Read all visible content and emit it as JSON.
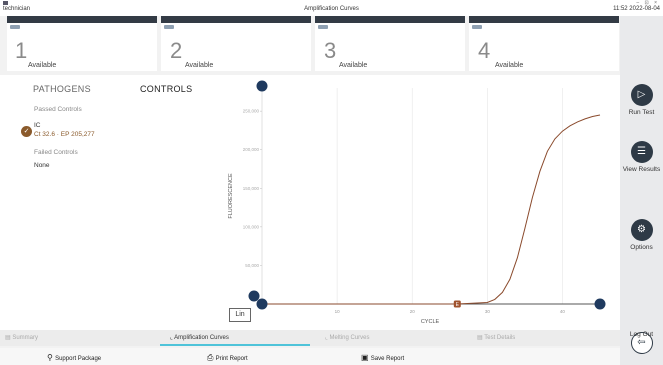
{
  "window": {
    "user": "technician",
    "title": "Amplification Curves",
    "clock": "11:52 2022-08-04",
    "controls": "–  ⊡  ×"
  },
  "modules": [
    {
      "number": "1",
      "status": "Available"
    },
    {
      "number": "2",
      "status": "Available"
    },
    {
      "number": "3",
      "status": "Available"
    },
    {
      "number": "4",
      "status": "Available"
    }
  ],
  "left_panel": {
    "tab_pathogens": "PATHOGENS",
    "tab_controls": "CONTROLS",
    "passed_label": "Passed Controls",
    "control_name": "IC",
    "control_detail": "Ct 32.6 · EP 205,277",
    "failed_label": "Failed Controls",
    "failed_value": "None"
  },
  "chart_controls": {
    "scale_button": "Lin"
  },
  "chart_data": {
    "type": "line",
    "xlabel": "CYCLE",
    "ylabel": "FLUORESCENCE",
    "xlim": [
      0,
      45
    ],
    "ylim": [
      0,
      280000
    ],
    "x_ticks": [
      10,
      20,
      30,
      40
    ],
    "y_ticks": [
      50000,
      100000,
      150000,
      200000,
      250000
    ],
    "y_tick_labels": [
      "50,000",
      "100,000",
      "150,000",
      "200,000",
      "250,000"
    ],
    "series": [
      {
        "name": "IC",
        "color": "#8a4a2c",
        "x": [
          0,
          26,
          30,
          31,
          32,
          33,
          34,
          35,
          36,
          37,
          38,
          39,
          40,
          41,
          42,
          43,
          44,
          45
        ],
        "y": [
          0,
          0,
          2000,
          6000,
          15000,
          32000,
          60000,
          98000,
          138000,
          172000,
          198000,
          214000,
          224000,
          231000,
          236000,
          240000,
          243000,
          245000
        ]
      }
    ],
    "marker": {
      "label": "E",
      "x": 26,
      "color": "#a0522d"
    },
    "grid": "vertical",
    "handle_color": "#1f3a5f"
  },
  "bottom_tabs": [
    {
      "label": "Summary",
      "icon": "summary-icon"
    },
    {
      "label": "Amplification Curves",
      "icon": "curve-icon"
    },
    {
      "label": "Melting Curves",
      "icon": "melting-icon"
    },
    {
      "label": "Test Details",
      "icon": "details-icon"
    }
  ],
  "actions": {
    "support": "Support Package",
    "print": "Print Report",
    "save": "Save Report"
  },
  "rail": {
    "run": "Run Test",
    "view": "View Results",
    "options": "Options",
    "logout": "Log Out"
  },
  "colors": {
    "accent": "#2e3a46",
    "check": "#8a5a2b",
    "curve": "#8a4a2c",
    "handle": "#1f3a5f"
  }
}
